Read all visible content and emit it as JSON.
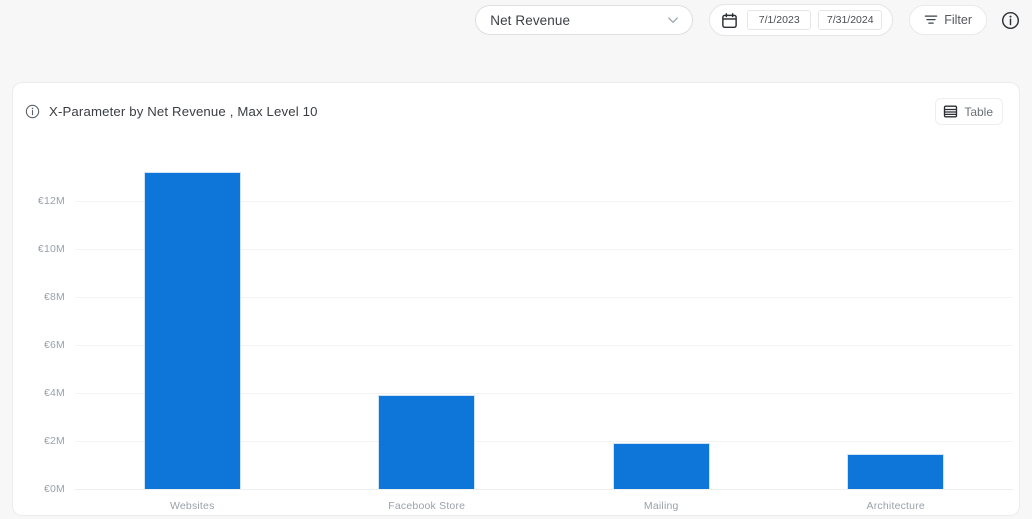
{
  "toolbar": {
    "metric_select": {
      "value": "Net Revenue",
      "icon": "chevron-down-icon"
    },
    "date_range": {
      "icon": "calendar-icon",
      "start": "7/1/2023",
      "end": "7/31/2024"
    },
    "filter_button": {
      "label": "Filter",
      "icon": "filter-icon"
    },
    "info_icon": "info-circle-icon"
  },
  "card": {
    "info_icon": "info-circle-icon",
    "title": "X-Parameter by Net Revenue , Max Level 10",
    "table_button": {
      "label": "Table",
      "icon": "table-icon"
    }
  },
  "chart_data": {
    "type": "bar",
    "title": "X-Parameter by Net Revenue , Max Level 10",
    "xlabel": "",
    "ylabel": "",
    "categories": [
      "Websites",
      "Facebook Store",
      "Mailing",
      "Architecture"
    ],
    "values": [
      13.2,
      3.9,
      1.9,
      1.45
    ],
    "value_unit": "€M",
    "ytick_labels": [
      "€0M",
      "€2M",
      "€4M",
      "€6M",
      "€8M",
      "€10M",
      "€12M"
    ],
    "ytick_values": [
      0,
      2,
      4,
      6,
      8,
      10,
      12
    ],
    "ylim": [
      0,
      13.4
    ],
    "grid": true,
    "legend": false,
    "series": [
      {
        "name": "Net Revenue",
        "color": "#0d76d8",
        "values": [
          13.2,
          3.9,
          1.9,
          1.45
        ]
      }
    ]
  },
  "colors": {
    "bar": "#0d76d8",
    "bar_border": "#cfe2f7",
    "page_background": "#f7f7f8",
    "card_background": "#ffffff",
    "gridline": "#f2f3f4",
    "axis_text": "#9aa1ab"
  }
}
